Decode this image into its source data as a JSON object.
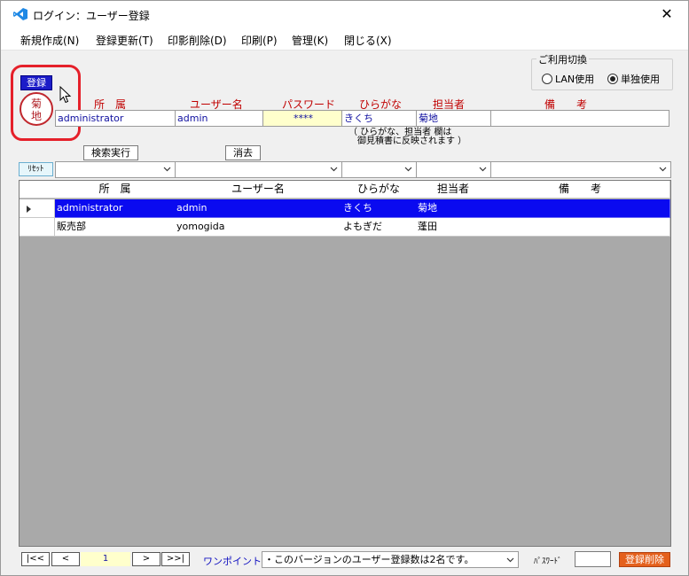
{
  "window": {
    "title": "ログイン：ユーザー登録",
    "close_glyph": "✕"
  },
  "menu": [
    "新規作成(N)",
    "登録更新(T)",
    "印影削除(D)",
    "印刷(P)",
    "管理(K)",
    "閉じる(X)"
  ],
  "usage_mode": {
    "legend": "ご利用切換",
    "options": [
      "LAN使用",
      "単独使用"
    ],
    "selected": "単独使用"
  },
  "register_button": "登録",
  "seal_text": "菊地",
  "form": {
    "labels": {
      "dept": "所　属",
      "user": "ユーザー名",
      "password": "パスワード",
      "kana": "ひらがな",
      "person": "担当者",
      "note": "備　　考"
    },
    "values": {
      "dept": "administrator",
      "user": "admin",
      "password": "****",
      "kana": "きくち",
      "person": "菊地",
      "note": ""
    },
    "hint": [
      "（ ひらがな、担当者 欄は",
      "　御見積書に反映されます ）"
    ]
  },
  "buttons": {
    "search": "検索実行",
    "clear": "消去",
    "reset": "ﾘｾｯﾄ"
  },
  "grid": {
    "columns": [
      "所　属",
      "ユーザー名",
      "ひらがな",
      "担当者",
      "備　　考"
    ],
    "rows": [
      [
        "administrator",
        "admin",
        "きくち",
        "菊地",
        ""
      ],
      [
        "販売部",
        "yomogida",
        "よもぎだ",
        "蓬田",
        ""
      ]
    ],
    "selected_row": 0
  },
  "footer": {
    "nav": [
      "|<<",
      "<",
      ">",
      ">>|"
    ],
    "page": "1",
    "tip_label": "ワンポイント:",
    "tip_text": "・このバージョンのユーザー登録数は2名です。",
    "password_label": "ﾊﾟｽﾜｰﾄﾞ",
    "delete_button": "登録削除"
  },
  "colors": {
    "selection": "#0a0af0",
    "label_red": "#c00000",
    "seal_red": "#c0272d",
    "delete_orange": "#e4601c"
  }
}
